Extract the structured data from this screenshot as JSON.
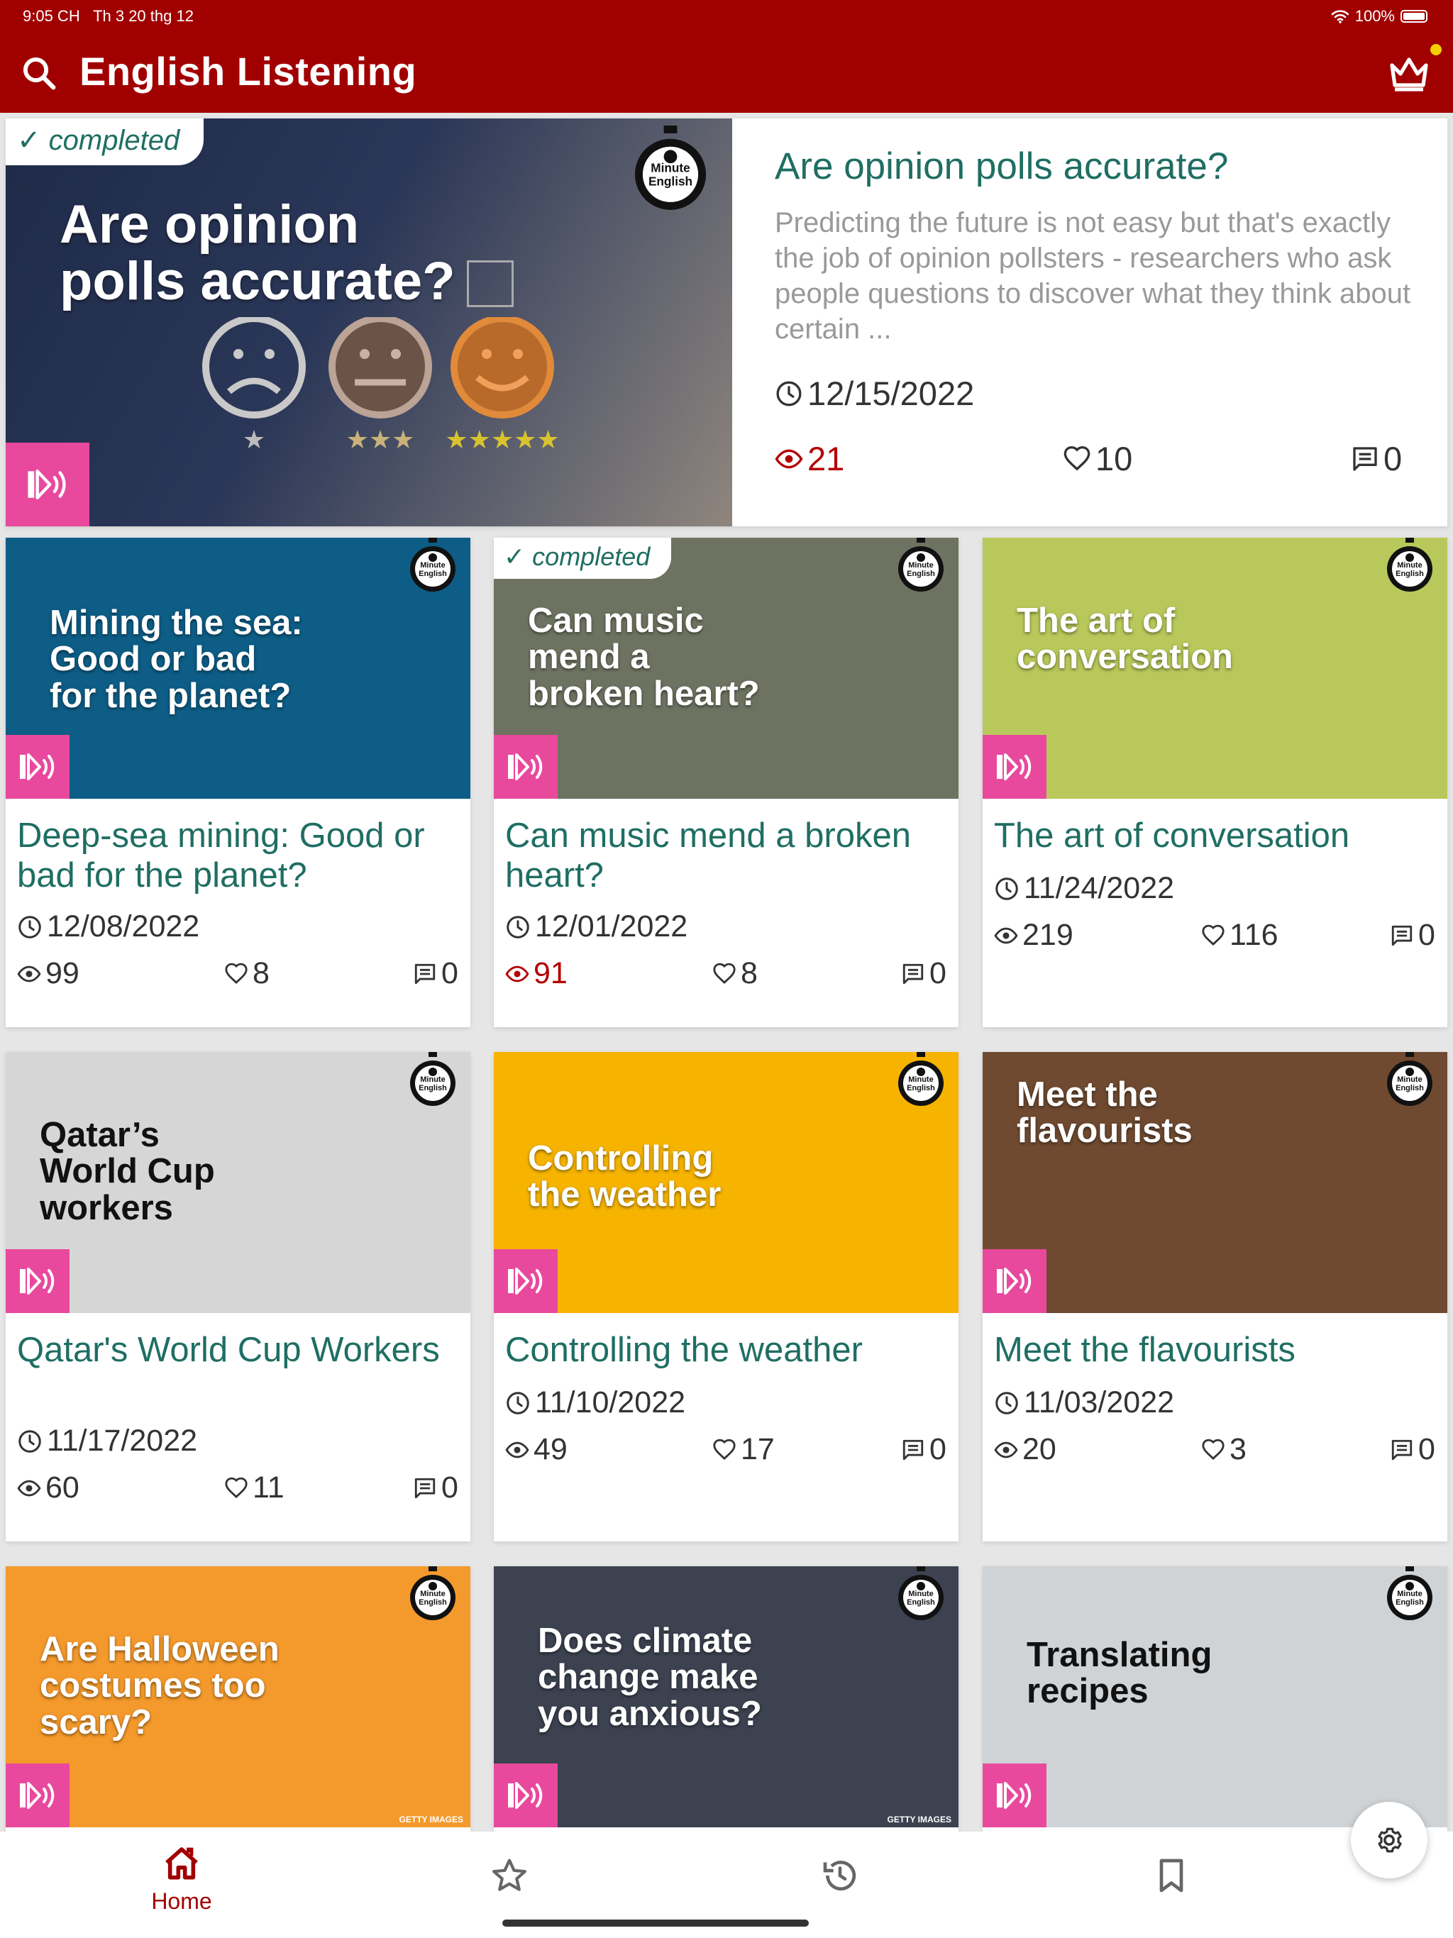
{
  "status_bar": {
    "time": "9:05 CH",
    "date": "Th 3 20 thg 12",
    "battery": "100%"
  },
  "app_bar": {
    "title": "English Listening",
    "search_icon": "search-icon",
    "premium_icon": "crown-icon"
  },
  "colors": {
    "app_bar": "#a10000",
    "title_teal": "#1f6e63",
    "audio_badge": "#e8499d",
    "views_red": "#b30000"
  },
  "featured": {
    "completed": "✓ completed",
    "thumb_caption": "Are opinion\npolls accurate?",
    "title": "Are opinion polls accurate?",
    "description": "Predicting the future is not easy but that's exactly the job of opinion pollsters - researchers who ask people questions to discover what they think about certain ...",
    "date": "12/15/2022",
    "views": "21",
    "likes": "10",
    "comments": "0"
  },
  "episodes": [
    {
      "thumb_caption": "Mining the sea:\nGood or bad\nfor the planet?",
      "title": "Deep-sea mining: Good or bad for the planet?",
      "date": "12/08/2022",
      "views": "99",
      "likes": "8",
      "comments": "0",
      "completed": "",
      "thumb_color": "#0d5d86"
    },
    {
      "thumb_caption": "Can music\nmend a\nbroken heart?",
      "title": "Can music mend a broken heart?",
      "date": "12/01/2022",
      "views": "91",
      "likes": "8",
      "comments": "0",
      "completed": "✓ completed",
      "thumb_color": "#6e7361"
    },
    {
      "thumb_caption": "The art of\nconversation",
      "title": "The art of conversation",
      "date": "11/24/2022",
      "views": "219",
      "likes": "116",
      "comments": "0",
      "completed": "",
      "thumb_color": "#b9c85a"
    },
    {
      "thumb_caption": "Qatar’s\nWorld Cup\nworkers",
      "title": "Qatar's World Cup Workers",
      "date": "11/17/2022",
      "views": "60",
      "likes": "11",
      "comments": "0",
      "completed": "",
      "thumb_color": "#d6d6d6"
    },
    {
      "thumb_caption": "Controlling\nthe weather",
      "title": "Controlling the weather",
      "date": "11/10/2022",
      "views": "49",
      "likes": "17",
      "comments": "0",
      "completed": "",
      "thumb_color": "#f6b400"
    },
    {
      "thumb_caption": "Meet the\nflavourists",
      "title": "Meet the flavourists",
      "date": "11/03/2022",
      "views": "20",
      "likes": "3",
      "comments": "0",
      "completed": "",
      "thumb_color": "#6f4a31"
    },
    {
      "thumb_caption": "Are Halloween\ncostumes too\nscary?",
      "title": "",
      "date": "",
      "views": "",
      "likes": "",
      "comments": "",
      "completed": "",
      "thumb_color": "#f49a2c",
      "credit": "GETTY IMAGES"
    },
    {
      "thumb_caption": "Does climate\nchange make\nyou anxious?",
      "title": "",
      "date": "",
      "views": "",
      "likes": "",
      "comments": "",
      "completed": "",
      "thumb_color": "#3c4250",
      "credit": "GETTY IMAGES"
    },
    {
      "thumb_caption": "Translating\nrecipes",
      "title": "",
      "date": "",
      "views": "",
      "likes": "",
      "comments": "",
      "completed": "",
      "thumb_color": "#cfd3d6"
    }
  ],
  "bottom_nav": {
    "items": [
      {
        "label": "Home",
        "icon": "home-icon",
        "active": true
      },
      {
        "label": "",
        "icon": "star-icon",
        "active": false
      },
      {
        "label": "",
        "icon": "history-icon",
        "active": false
      },
      {
        "label": "",
        "icon": "bookmark-icon",
        "active": false
      }
    ]
  },
  "fab_icon": "settings-icon"
}
